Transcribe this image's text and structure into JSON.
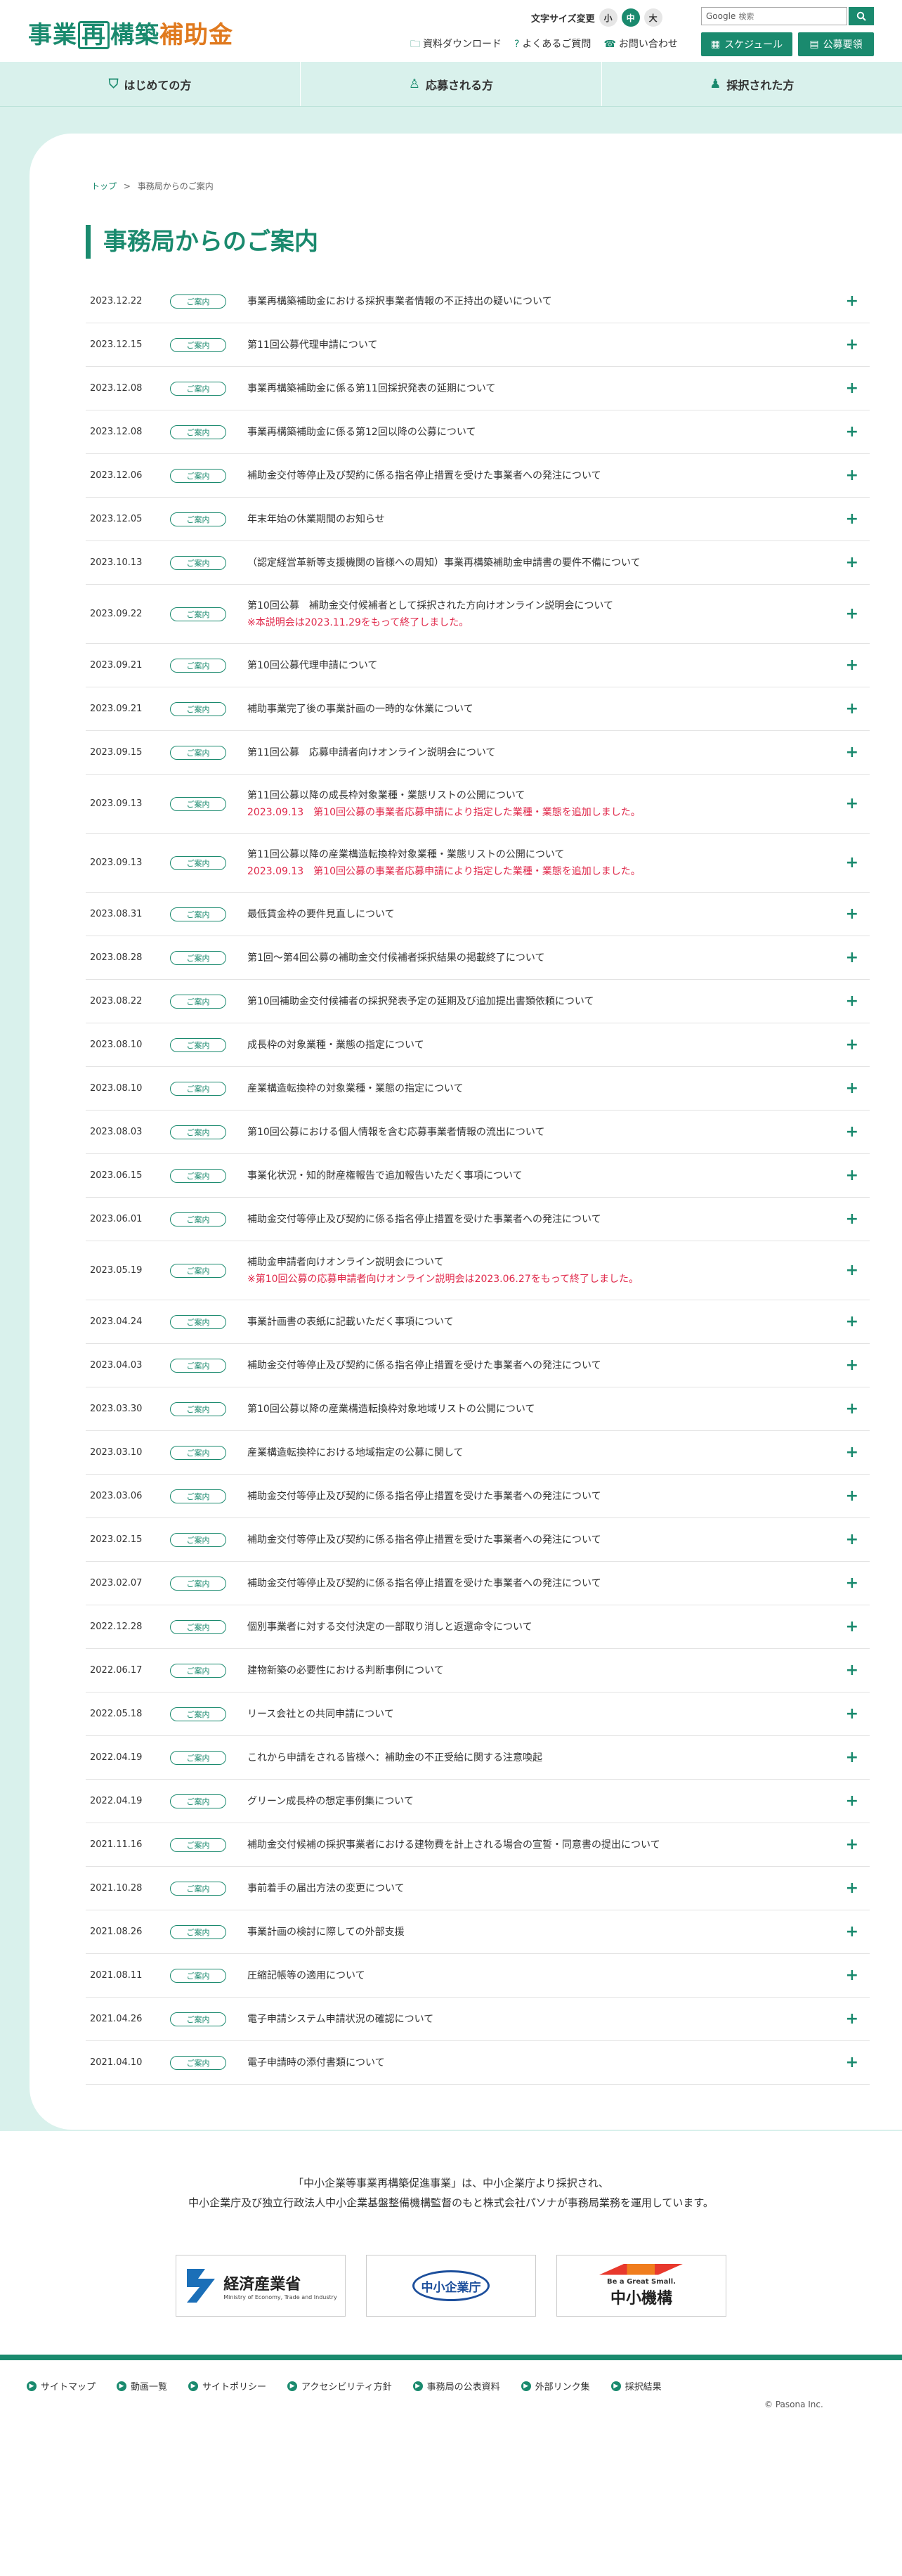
{
  "header": {
    "logo_part1": "事業",
    "logo_part2": "再",
    "logo_part3": "構築",
    "logo_part4": "補助金",
    "font_size_label": "文字サイズ変更",
    "font_sizes": [
      "小",
      "中",
      "大"
    ],
    "search_brand": "Google",
    "search_placeholder": "検索",
    "links": [
      {
        "label": "資料ダウンロード",
        "icon": "folder-icon"
      },
      {
        "label": "よくあるご質問",
        "icon": "question-icon"
      },
      {
        "label": "お問い合わせ",
        "icon": "phone-icon"
      }
    ],
    "schedule_button": "スケジュール",
    "guideline_button": "公募要領"
  },
  "global_nav": [
    {
      "label": "はじめての方",
      "icon": "shield-icon"
    },
    {
      "label": "応募される方",
      "icon": "person-outline-icon"
    },
    {
      "label": "採択された方",
      "icon": "person-icon"
    }
  ],
  "breadcrumb": {
    "home": "トップ",
    "separator": ">",
    "current": "事務局からのご案内"
  },
  "page_title": "事務局からのご案内",
  "news": [
    {
      "date": "2023.12.22",
      "badge": "ご案内",
      "title": "事業再構築補助金における採択事業者情報の不正持出の疑いについて",
      "note": ""
    },
    {
      "date": "2023.12.15",
      "badge": "ご案内",
      "title": "第11回公募代理申請について",
      "note": ""
    },
    {
      "date": "2023.12.08",
      "badge": "ご案内",
      "title": "事業再構築補助金に係る第11回採択発表の延期について",
      "note": ""
    },
    {
      "date": "2023.12.08",
      "badge": "ご案内",
      "title": "事業再構築補助金に係る第12回以降の公募について",
      "note": ""
    },
    {
      "date": "2023.12.06",
      "badge": "ご案内",
      "title": "補助金交付等停止及び契約に係る指名停止措置を受けた事業者への発注について",
      "note": ""
    },
    {
      "date": "2023.12.05",
      "badge": "ご案内",
      "title": "年末年始の休業期間のお知らせ",
      "note": ""
    },
    {
      "date": "2023.10.13",
      "badge": "ご案内",
      "title": "（認定経営革新等支援機関の皆様への周知）事業再構築補助金申請書の要件不備について",
      "note": ""
    },
    {
      "date": "2023.09.22",
      "badge": "ご案内",
      "title": "第10回公募　補助金交付候補者として採択された方向けオンライン説明会について",
      "note": "※本説明会は2023.11.29をもって終了しました。"
    },
    {
      "date": "2023.09.21",
      "badge": "ご案内",
      "title": "第10回公募代理申請について",
      "note": ""
    },
    {
      "date": "2023.09.21",
      "badge": "ご案内",
      "title": "補助事業完了後の事業計画の一時的な休業について",
      "note": ""
    },
    {
      "date": "2023.09.15",
      "badge": "ご案内",
      "title": "第11回公募　応募申請者向けオンライン説明会について",
      "note": ""
    },
    {
      "date": "2023.09.13",
      "badge": "ご案内",
      "title": "第11回公募以降の成長枠対象業種・業態リストの公開について",
      "note": "2023.09.13　第10回公募の事業者応募申請により指定した業種・業態を追加しました。"
    },
    {
      "date": "2023.09.13",
      "badge": "ご案内",
      "title": "第11回公募以降の産業構造転換枠対象業種・業態リストの公開について",
      "note": "2023.09.13　第10回公募の事業者応募申請により指定した業種・業態を追加しました。"
    },
    {
      "date": "2023.08.31",
      "badge": "ご案内",
      "title": "最低賃金枠の要件見直しについて",
      "note": ""
    },
    {
      "date": "2023.08.28",
      "badge": "ご案内",
      "title": "第1回〜第4回公募の補助金交付候補者採択結果の掲載終了について",
      "note": ""
    },
    {
      "date": "2023.08.22",
      "badge": "ご案内",
      "title": "第10回補助金交付候補者の採択発表予定の延期及び追加提出書類依頼について",
      "note": ""
    },
    {
      "date": "2023.08.10",
      "badge": "ご案内",
      "title": "成長枠の対象業種・業態の指定について",
      "note": ""
    },
    {
      "date": "2023.08.10",
      "badge": "ご案内",
      "title": "産業構造転換枠の対象業種・業態の指定について",
      "note": ""
    },
    {
      "date": "2023.08.03",
      "badge": "ご案内",
      "title": "第10回公募における個人情報を含む応募事業者情報の流出について",
      "note": ""
    },
    {
      "date": "2023.06.15",
      "badge": "ご案内",
      "title": "事業化状況・知的財産権報告で追加報告いただく事項について",
      "note": ""
    },
    {
      "date": "2023.06.01",
      "badge": "ご案内",
      "title": "補助金交付等停止及び契約に係る指名停止措置を受けた事業者への発注について",
      "note": ""
    },
    {
      "date": "2023.05.19",
      "badge": "ご案内",
      "title": "補助金申請者向けオンライン説明会について",
      "note": "※第10回公募の応募申請者向けオンライン説明会は2023.06.27をもって終了しました。"
    },
    {
      "date": "2023.04.24",
      "badge": "ご案内",
      "title": "事業計画書の表紙に記載いただく事項について",
      "note": ""
    },
    {
      "date": "2023.04.03",
      "badge": "ご案内",
      "title": "補助金交付等停止及び契約に係る指名停止措置を受けた事業者への発注について",
      "note": ""
    },
    {
      "date": "2023.03.30",
      "badge": "ご案内",
      "title": "第10回公募以降の産業構造転換枠対象地域リストの公開について",
      "note": ""
    },
    {
      "date": "2023.03.10",
      "badge": "ご案内",
      "title": "産業構造転換枠における地域指定の公募に関して",
      "note": ""
    },
    {
      "date": "2023.03.06",
      "badge": "ご案内",
      "title": "補助金交付等停止及び契約に係る指名停止措置を受けた事業者への発注について",
      "note": ""
    },
    {
      "date": "2023.02.15",
      "badge": "ご案内",
      "title": "補助金交付等停止及び契約に係る指名停止措置を受けた事業者への発注について",
      "note": ""
    },
    {
      "date": "2023.02.07",
      "badge": "ご案内",
      "title": "補助金交付等停止及び契約に係る指名停止措置を受けた事業者への発注について",
      "note": ""
    },
    {
      "date": "2022.12.28",
      "badge": "ご案内",
      "title": "個別事業者に対する交付決定の一部取り消しと返還命令について",
      "note": ""
    },
    {
      "date": "2022.06.17",
      "badge": "ご案内",
      "title": "建物新築の必要性における判断事例について",
      "note": ""
    },
    {
      "date": "2022.05.18",
      "badge": "ご案内",
      "title": "リース会社との共同申請について",
      "note": ""
    },
    {
      "date": "2022.04.19",
      "badge": "ご案内",
      "title": "これから申請をされる皆様へ：補助金の不正受給に関する注意喚起",
      "note": ""
    },
    {
      "date": "2022.04.19",
      "badge": "ご案内",
      "title": "グリーン成長枠の想定事例集について",
      "note": ""
    },
    {
      "date": "2021.11.16",
      "badge": "ご案内",
      "title": "補助金交付候補の採択事業者における建物費を計上される場合の宣誓・同意書の提出について",
      "note": ""
    },
    {
      "date": "2021.10.28",
      "badge": "ご案内",
      "title": "事前着手の届出方法の変更について",
      "note": ""
    },
    {
      "date": "2021.08.26",
      "badge": "ご案内",
      "title": "事業計画の検討に際しての外部支援",
      "note": ""
    },
    {
      "date": "2021.08.11",
      "badge": "ご案内",
      "title": "圧縮記帳等の適用について",
      "note": ""
    },
    {
      "date": "2021.04.26",
      "badge": "ご案内",
      "title": "電子申請システム申請状況の確認について",
      "note": ""
    },
    {
      "date": "2021.04.10",
      "badge": "ご案内",
      "title": "電子申請時の添付書類について",
      "note": ""
    }
  ],
  "footer": {
    "intro_line1": "「中小企業等事業再構築促進事業」は、中小企業庁より採択され、",
    "intro_line2": "中小企業庁及び独立行政法人中小企業基盤整備機構監督のもと株式会社パソナが事務局業務を運用しています。",
    "logos": {
      "meti_name": "経済産業省",
      "meti_sub": "Ministry of Economy, Trade and Industry",
      "chusho": "中小企業庁",
      "smrj_tag": "Be a Great Small.",
      "smrj_name": "中小機構"
    },
    "links": [
      "サイトマップ",
      "動画一覧",
      "サイトポリシー",
      "アクセシビリティ方針",
      "事務局の公表資料",
      "外部リンク集",
      "採択結果"
    ],
    "copyright": "© Pasona Inc."
  },
  "colors": {
    "brand": "#1a8a6e",
    "accent": "#e07a1f",
    "nav_bg": "#d9f1ec",
    "note_red": "#e0284a"
  }
}
